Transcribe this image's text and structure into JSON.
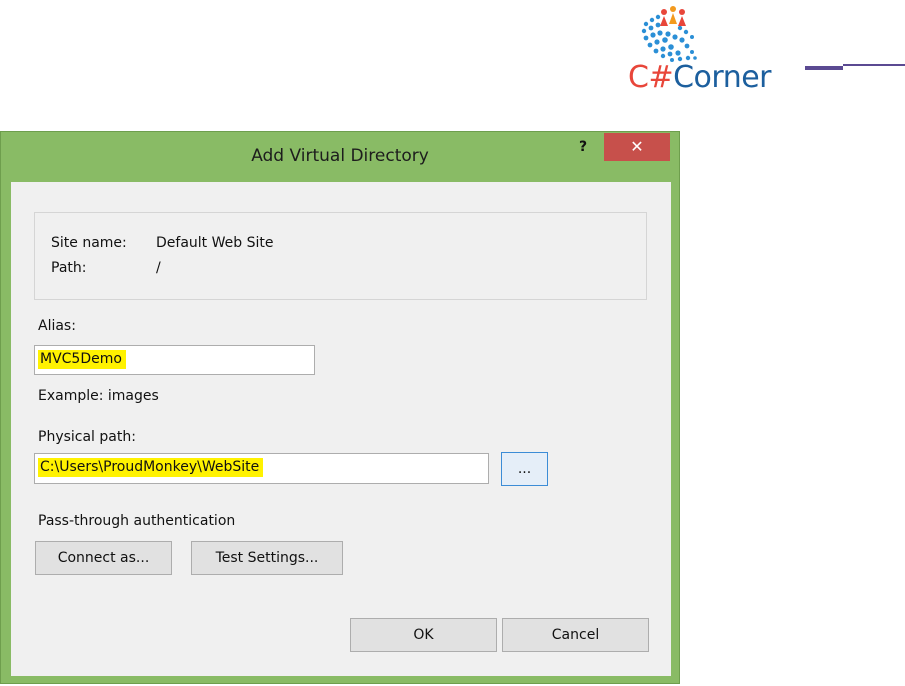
{
  "logo": {
    "text_part1": "C#",
    "text_part2": "Corner",
    "colors": {
      "red": "#e8463a",
      "blue": "#1c5f9e",
      "purple": "#5b4a92"
    }
  },
  "dialog": {
    "title": "Add Virtual Directory",
    "help_label": "?",
    "close_label": "✕",
    "site_name_label": "Site name:",
    "site_name_value": "Default Web Site",
    "path_label": "Path:",
    "path_value": "/",
    "alias_label": "Alias:",
    "alias_value": "MVC5Demo",
    "example_text": "Example: images",
    "physical_path_label": "Physical path:",
    "physical_path_value": "C:\\Users\\ProudMonkey\\WebSite",
    "browse_label": "...",
    "passthrough_label": "Pass-through authentication",
    "connect_as_label": "Connect as...",
    "test_settings_label": "Test Settings...",
    "ok_label": "OK",
    "cancel_label": "Cancel"
  },
  "colors": {
    "window_frame": "#89bb65",
    "close_button": "#c7504b",
    "highlight": "#fff200",
    "client_bg": "#f0f0f0"
  }
}
